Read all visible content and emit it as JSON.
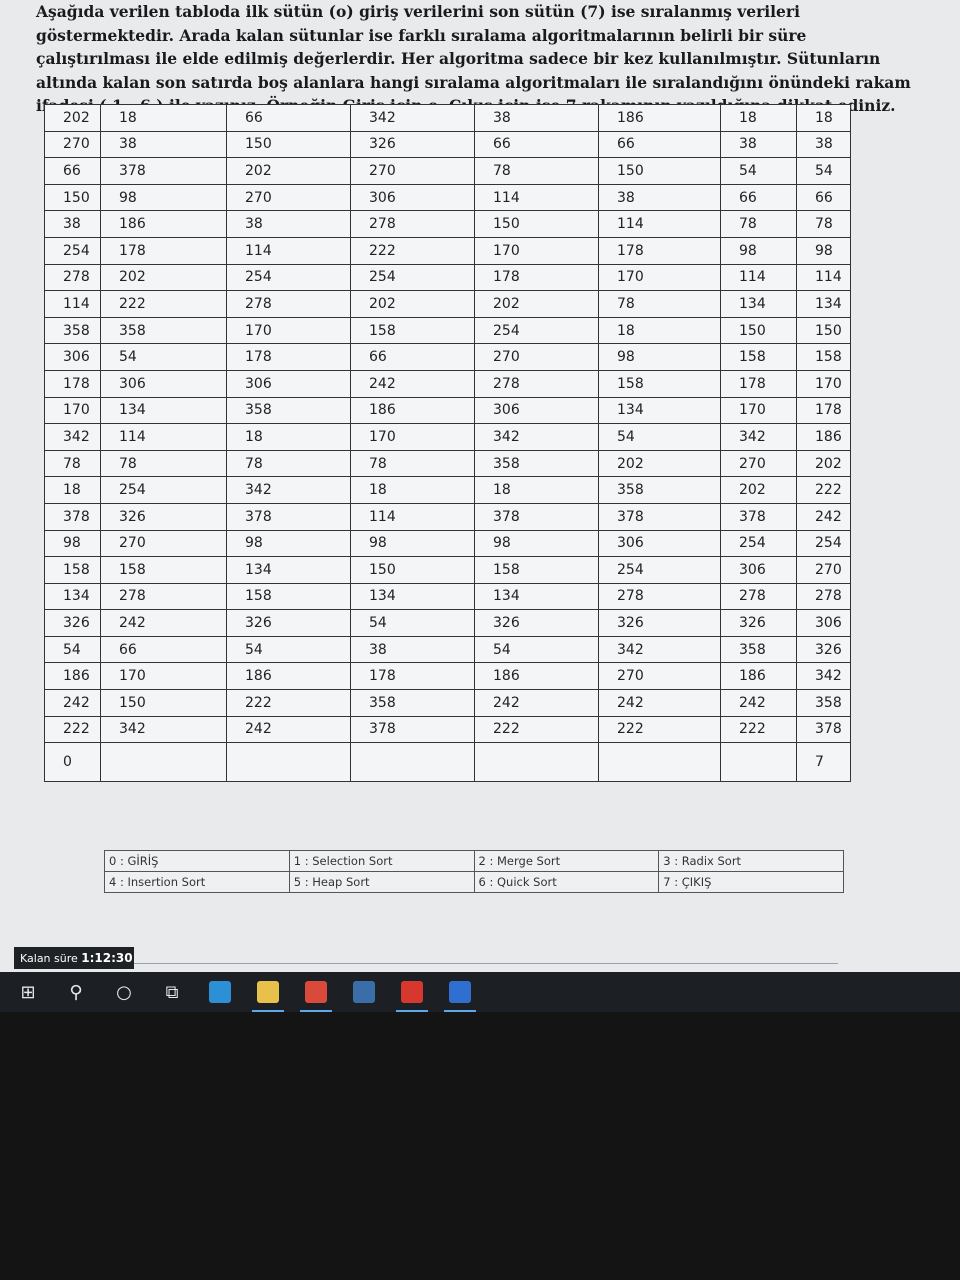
{
  "instructions": "Aşağıda verilen tabloda ilk sütün (o) giriş verilerini son sütün (7) ise sıralanmış verileri göstermektedir. Arada kalan sütunlar ise farklı sıralama algoritmalarının belirli bir süre çalıştırılması ile elde edilmiş değerlerdir. Her algoritma sadece bir kez kullanılmıştır. Sütunların altında kalan son satırda boş alanlara hangi sıralama algoritmaları ile sıralandığını önündeki rakam ifadesi ( 1 - 6 ) ile yazınız. Örneğin Giriş için o, Çıkış için ise 7 rakamının yazıldığına dikkat ediniz.",
  "table": {
    "rows": [
      [
        "202",
        "18",
        "66",
        "342",
        "38",
        "186",
        "18",
        "18"
      ],
      [
        "270",
        "38",
        "150",
        "326",
        "66",
        "66",
        "38",
        "38"
      ],
      [
        "66",
        "378",
        "202",
        "270",
        "78",
        "150",
        "54",
        "54"
      ],
      [
        "150",
        "98",
        "270",
        "306",
        "114",
        "38",
        "66",
        "66"
      ],
      [
        "38",
        "186",
        "38",
        "278",
        "150",
        "114",
        "78",
        "78"
      ],
      [
        "254",
        "178",
        "114",
        "222",
        "170",
        "178",
        "98",
        "98"
      ],
      [
        "278",
        "202",
        "254",
        "254",
        "178",
        "170",
        "114",
        "114"
      ],
      [
        "114",
        "222",
        "278",
        "202",
        "202",
        "78",
        "134",
        "134"
      ],
      [
        "358",
        "358",
        "170",
        "158",
        "254",
        "18",
        "150",
        "150"
      ],
      [
        "306",
        "54",
        "178",
        "66",
        "270",
        "98",
        "158",
        "158"
      ],
      [
        "178",
        "306",
        "306",
        "242",
        "278",
        "158",
        "178",
        "170"
      ],
      [
        "170",
        "134",
        "358",
        "186",
        "306",
        "134",
        "170",
        "178"
      ],
      [
        "342",
        "114",
        "18",
        "170",
        "342",
        "54",
        "342",
        "186"
      ],
      [
        "78",
        "78",
        "78",
        "78",
        "358",
        "202",
        "270",
        "202"
      ],
      [
        "18",
        "254",
        "342",
        "18",
        "18",
        "358",
        "202",
        "222"
      ],
      [
        "378",
        "326",
        "378",
        "114",
        "378",
        "378",
        "378",
        "242"
      ],
      [
        "98",
        "270",
        "98",
        "98",
        "98",
        "306",
        "254",
        "254"
      ],
      [
        "158",
        "158",
        "134",
        "150",
        "158",
        "254",
        "306",
        "270"
      ],
      [
        "134",
        "278",
        "158",
        "134",
        "134",
        "278",
        "278",
        "278"
      ],
      [
        "326",
        "242",
        "326",
        "54",
        "326",
        "326",
        "326",
        "306"
      ],
      [
        "54",
        "66",
        "54",
        "38",
        "54",
        "342",
        "358",
        "326"
      ],
      [
        "186",
        "170",
        "186",
        "178",
        "186",
        "270",
        "186",
        "342"
      ],
      [
        "242",
        "150",
        "222",
        "358",
        "242",
        "242",
        "242",
        "358"
      ],
      [
        "222",
        "342",
        "242",
        "378",
        "222",
        "222",
        "222",
        "378"
      ]
    ],
    "answer_row": [
      "0",
      "",
      "",
      "",
      "",
      "",
      "",
      "7"
    ]
  },
  "legend": [
    [
      "0 : GİRİŞ",
      "1 : Selection Sort",
      "2 : Merge Sort",
      "3 : Radix Sort"
    ],
    [
      "4 : Insertion Sort",
      "5 : Heap Sort",
      "6 : Quick Sort",
      "7 : ÇIKIŞ"
    ]
  ],
  "timer": {
    "label": "Kalan süre",
    "value": "1:12:30"
  },
  "taskbar": [
    {
      "name": "windows-start-icon",
      "glyph": "⊞"
    },
    {
      "name": "search-icon",
      "glyph": "⚲"
    },
    {
      "name": "cortana-icon",
      "glyph": "○"
    },
    {
      "name": "task-view-icon",
      "glyph": "⧉"
    },
    {
      "name": "edge-icon",
      "color": "#2d8fd6"
    },
    {
      "name": "file-explorer-icon",
      "color": "#e8c04a"
    },
    {
      "name": "chrome-icon",
      "color": "#d94a3a"
    },
    {
      "name": "steam-icon",
      "color": "#3a6ea8"
    },
    {
      "name": "acrobat-icon",
      "color": "#d6382e"
    },
    {
      "name": "app-icon",
      "color": "#2f6fd0"
    }
  ]
}
